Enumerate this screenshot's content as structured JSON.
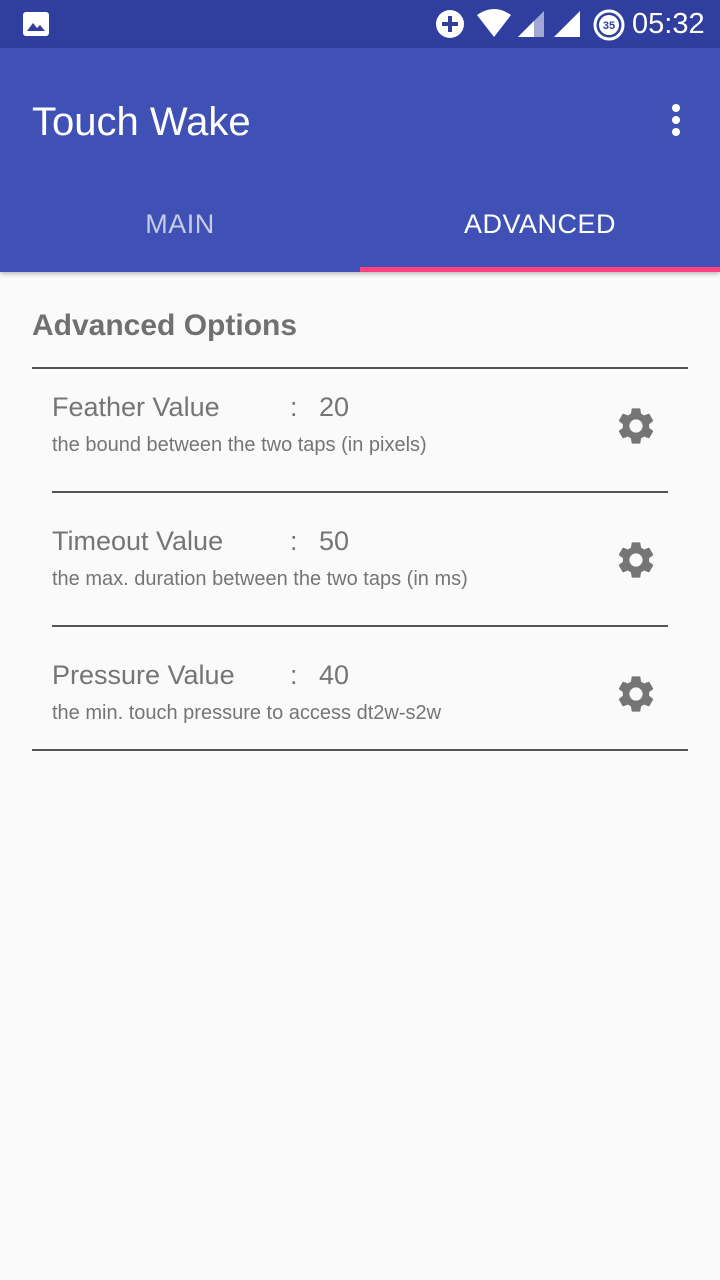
{
  "status_bar": {
    "time": "05:32",
    "battery_level": "35",
    "icons": [
      "gallery-icon",
      "plus-circle-icon",
      "wifi-icon",
      "signal-icon",
      "signal-icon",
      "battery-saver-icon"
    ]
  },
  "app_bar": {
    "title": "Touch Wake",
    "overflow_icon": "more-vert-icon"
  },
  "tabs": [
    {
      "label": "MAIN",
      "selected": false
    },
    {
      "label": "ADVANCED",
      "selected": true
    }
  ],
  "advanced": {
    "section_title": "Advanced Options",
    "options": [
      {
        "name": "Feather Value",
        "separator": ":",
        "value": "20",
        "description": "the bound between the two taps (in pixels)",
        "icon": "gear-icon"
      },
      {
        "name": "Timeout Value",
        "separator": ":",
        "value": "50",
        "description": "the max. duration between the two taps (in ms)",
        "icon": "gear-icon"
      },
      {
        "name": "Pressure Value",
        "separator": ":",
        "value": "40",
        "description": "the min. touch pressure to access dt2w-s2w",
        "icon": "gear-icon"
      }
    ]
  },
  "colors": {
    "primary": "#3f51b5",
    "primary_dark": "#303f9f",
    "accent": "#ff4081",
    "text_secondary": "#757575",
    "background": "#fafafa"
  }
}
